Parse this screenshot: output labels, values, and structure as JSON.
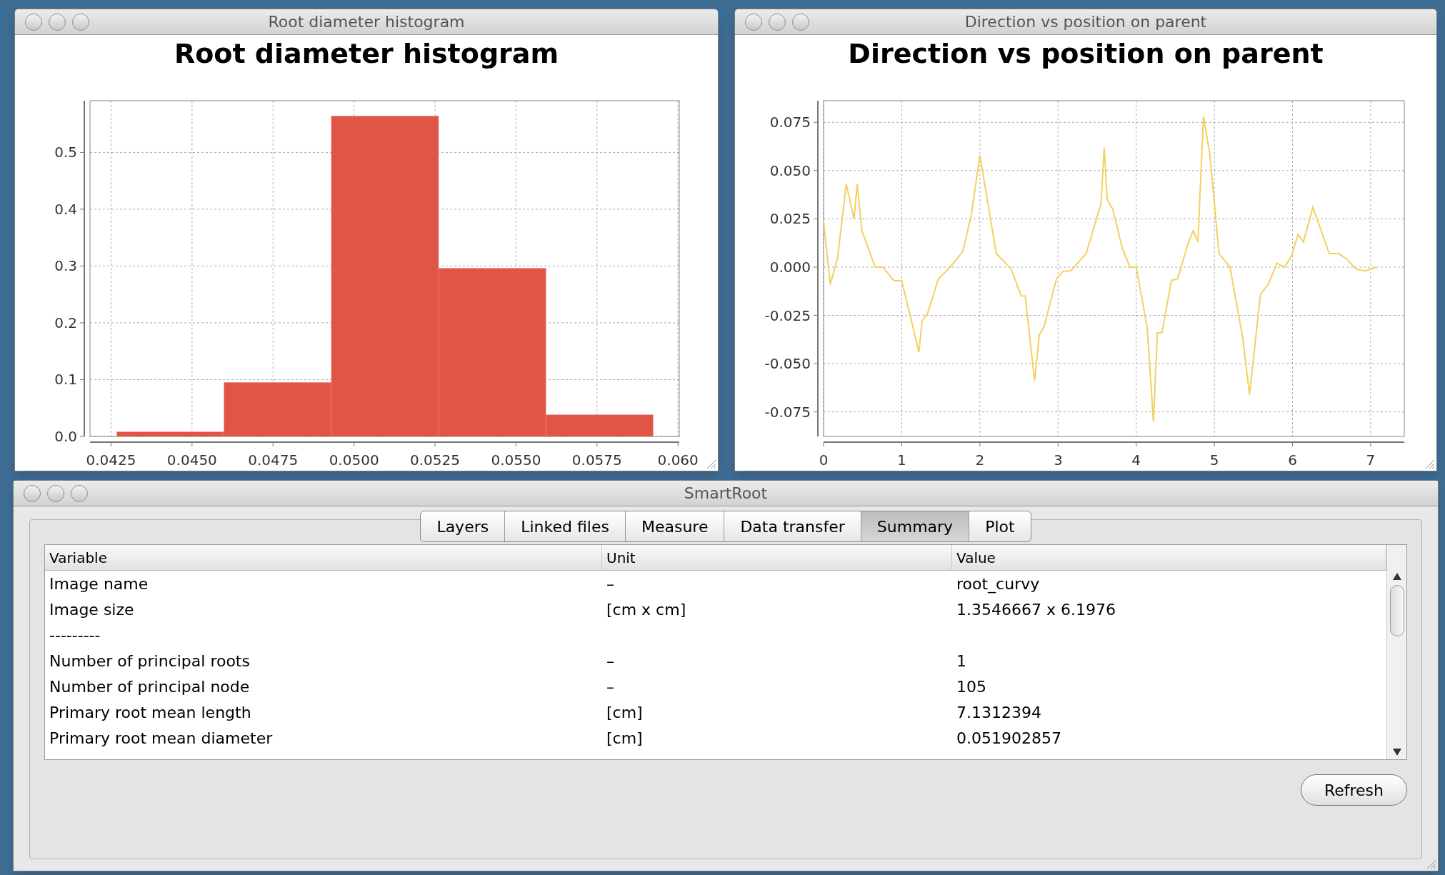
{
  "histogram_window": {
    "title": "Root diameter histogram",
    "chart_data": {
      "type": "bar",
      "title": "Root diameter histogram",
      "x": [
        0.044335,
        0.047645,
        0.050955,
        0.054265,
        0.057575
      ],
      "values": [
        0.008,
        0.095,
        0.564,
        0.296,
        0.038
      ],
      "grid": true,
      "color": "#e05545",
      "xlim": [
        0.04185,
        0.06004
      ],
      "ylim": [
        0,
        0.591
      ],
      "xticks": [
        {
          "value": 0.0425,
          "label": "0.0425"
        },
        {
          "value": 0.045,
          "label": "0.0450"
        },
        {
          "value": 0.0475,
          "label": "0.0475"
        },
        {
          "value": 0.05,
          "label": "0.0500"
        },
        {
          "value": 0.0525,
          "label": "0.0525"
        },
        {
          "value": 0.055,
          "label": "0.0550"
        },
        {
          "value": 0.0575,
          "label": "0.0575"
        },
        {
          "value": 0.06,
          "label": "0.060"
        }
      ],
      "yticks": [
        {
          "value": 0,
          "label": "0.0"
        },
        {
          "value": 0.1,
          "label": "0.1"
        },
        {
          "value": 0.2,
          "label": "0.2"
        },
        {
          "value": 0.3,
          "label": "0.3"
        },
        {
          "value": 0.4,
          "label": "0.4"
        },
        {
          "value": 0.5,
          "label": "0.5"
        }
      ]
    }
  },
  "line_window": {
    "title": "Direction vs position on parent",
    "chart_data": {
      "type": "line",
      "title": "Direction vs position on parent",
      "x": [
        0,
        0.086,
        0.18,
        0.29,
        0.39,
        0.43,
        0.49,
        0.66,
        0.76,
        0.9,
        1.0,
        1.22,
        1.26,
        1.33,
        1.47,
        1.62,
        1.78,
        1.89,
        2.0,
        2.07,
        2.21,
        2.4,
        2.53,
        2.58,
        2.7,
        2.76,
        2.82,
        2.98,
        3.07,
        3.16,
        3.36,
        3.55,
        3.59,
        3.63,
        3.7,
        3.82,
        3.92,
        4.0,
        4.14,
        4.22,
        4.27,
        4.33,
        4.45,
        4.53,
        4.67,
        4.73,
        4.79,
        4.86,
        4.94,
        5.06,
        5.2,
        5.36,
        5.45,
        5.59,
        5.69,
        5.8,
        5.9,
        5.99,
        6.07,
        6.14,
        6.26,
        6.47,
        6.59,
        6.7,
        6.81,
        6.93,
        7.07
      ],
      "grid": true,
      "color": "#f5cf5f",
      "values": [
        0.024,
        -0.009,
        0.005,
        0.043,
        0.025,
        0.043,
        0.019,
        0.0,
        0.0,
        -0.007,
        -0.007,
        -0.044,
        -0.028,
        -0.024,
        -0.006,
        0.0,
        0.008,
        0.027,
        0.058,
        0.041,
        0.007,
        -0.001,
        -0.015,
        -0.015,
        -0.059,
        -0.035,
        -0.031,
        -0.006,
        -0.002,
        -0.002,
        0.007,
        0.033,
        0.062,
        0.035,
        0.03,
        0.01,
        0.0,
        0.0,
        -0.031,
        -0.08,
        -0.034,
        -0.034,
        -0.007,
        -0.006,
        0.013,
        0.019,
        0.013,
        0.078,
        0.059,
        0.007,
        0.0,
        -0.036,
        -0.066,
        -0.014,
        -0.009,
        0.002,
        0.0,
        0.006,
        0.017,
        0.013,
        0.031,
        0.007,
        0.007,
        0.004,
        -0.001,
        -0.002,
        0.0
      ],
      "xlim": [
        0,
        7.43
      ],
      "ylim": [
        -0.0877,
        0.0862
      ],
      "xticks": [
        {
          "value": 0,
          "label": "0"
        },
        {
          "value": 1,
          "label": "1"
        },
        {
          "value": 2,
          "label": "2"
        },
        {
          "value": 3,
          "label": "3"
        },
        {
          "value": 4,
          "label": "4"
        },
        {
          "value": 5,
          "label": "5"
        },
        {
          "value": 6,
          "label": "6"
        },
        {
          "value": 7,
          "label": "7"
        }
      ],
      "yticks": [
        {
          "value": 0.075,
          "label": "0.075"
        },
        {
          "value": 0.05,
          "label": "0.050"
        },
        {
          "value": 0.025,
          "label": "0.025"
        },
        {
          "value": 0,
          "label": "0.000"
        },
        {
          "value": -0.025,
          "label": "-0.025"
        },
        {
          "value": -0.05,
          "label": "-0.050"
        },
        {
          "value": -0.075,
          "label": "-0.075"
        }
      ]
    }
  },
  "smartroot_window": {
    "title": "SmartRoot",
    "tabs": [
      {
        "label": "Layers",
        "selected": false
      },
      {
        "label": "Linked files",
        "selected": false
      },
      {
        "label": "Measure",
        "selected": false
      },
      {
        "label": "Data transfer",
        "selected": false
      },
      {
        "label": "Summary",
        "selected": true
      },
      {
        "label": "Plot",
        "selected": false
      }
    ],
    "table": {
      "columns": [
        "Variable",
        "Unit",
        "Value"
      ],
      "rows": [
        [
          "Image name",
          "–",
          "root_curvy"
        ],
        [
          "Image size",
          "[cm x cm]",
          "1.3546667 x 6.1976"
        ],
        [
          "---------"
        ],
        [
          "Number of principal roots",
          "–",
          "1"
        ],
        [
          "Number of principal node",
          "–",
          "105"
        ],
        [
          "Primary root mean length",
          "[cm]",
          "7.1312394"
        ],
        [
          "Primary root mean diameter",
          "[cm]",
          "0.051902857"
        ]
      ]
    },
    "buttons": [
      "Refresh"
    ]
  }
}
